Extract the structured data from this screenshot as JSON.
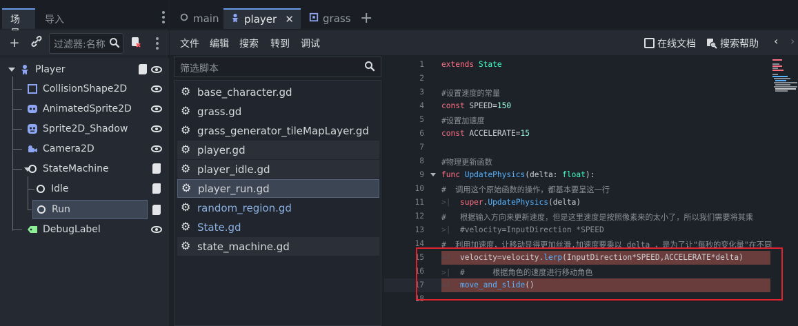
{
  "left_panel": {
    "tabs": [
      "场景",
      "导入"
    ],
    "filter_placeholder": "过滤器:名称",
    "tree": [
      {
        "label": "Player",
        "icon": "character-body-icon"
      },
      {
        "label": "CollisionShape2D",
        "icon": "collision-shape-icon"
      },
      {
        "label": "AnimatedSprite2D",
        "icon": "animated-sprite-icon"
      },
      {
        "label": "Sprite2D_Shadow",
        "icon": "sprite-icon"
      },
      {
        "label": "Camera2D",
        "icon": "camera-icon"
      },
      {
        "label": "StateMachine",
        "icon": "node-icon"
      },
      {
        "label": "Idle",
        "icon": "node-icon"
      },
      {
        "label": "Run",
        "icon": "node-icon"
      },
      {
        "label": "DebugLabel",
        "icon": "label-icon"
      }
    ]
  },
  "tabs": {
    "main": "main",
    "player": "player",
    "grass": "grass",
    "add": "+"
  },
  "menubar": {
    "items": [
      "文件",
      "编辑",
      "搜索",
      "转到",
      "调试"
    ],
    "online_docs": "在线文档",
    "search_help": "搜索帮助"
  },
  "script_panel": {
    "filter_placeholder": "筛选脚本",
    "scripts": [
      "base_character.gd",
      "grass.gd",
      "grass_generator_tileMapLayer.gd",
      "player.gd",
      "player_idle.gd",
      "player_run.gd",
      "random_region.gd",
      "State.gd",
      "state_machine.gd"
    ]
  },
  "editor": {
    "line_numbers": [
      "1",
      "2",
      "3",
      "4",
      "5",
      "6",
      "7",
      "8",
      "9",
      "10",
      "11",
      "12",
      "13",
      "14",
      "15",
      "16",
      "17",
      "18"
    ],
    "lines": [
      "extends State",
      "",
      "#设置速度的常量",
      "const SPEED=150",
      "#设置加速度",
      "const ACCELERATE=15",
      "",
      "#物理更新函数",
      "func UpdatePhysics(delta: float):",
      "#  调用这个原始函数的操作，都基本要呈这一行",
      "  super.UpdatePhysics(delta)",
      "#   根据输入方向来更新速度，但是这里速度是按照像素来的太小了，所以我们需要将其乘",
      "  #velocity=InputDirection *SPEED",
      "#  利用加速度，让移动显得更加丝滑,加速度要乘以 delta ，是为了让\"每秒的变化量\"在不同",
      "  velocity=velocity.lerp(InputDirection*SPEED,ACCELERATE*delta)",
      "  #      根据角色的速度进行移动角色",
      "  move_and_slide()",
      ""
    ]
  },
  "colors": {
    "accent": "#699ce8",
    "highlight_red": "#e0232e",
    "keyword": "#ff7085",
    "function": "#57b3ff"
  }
}
